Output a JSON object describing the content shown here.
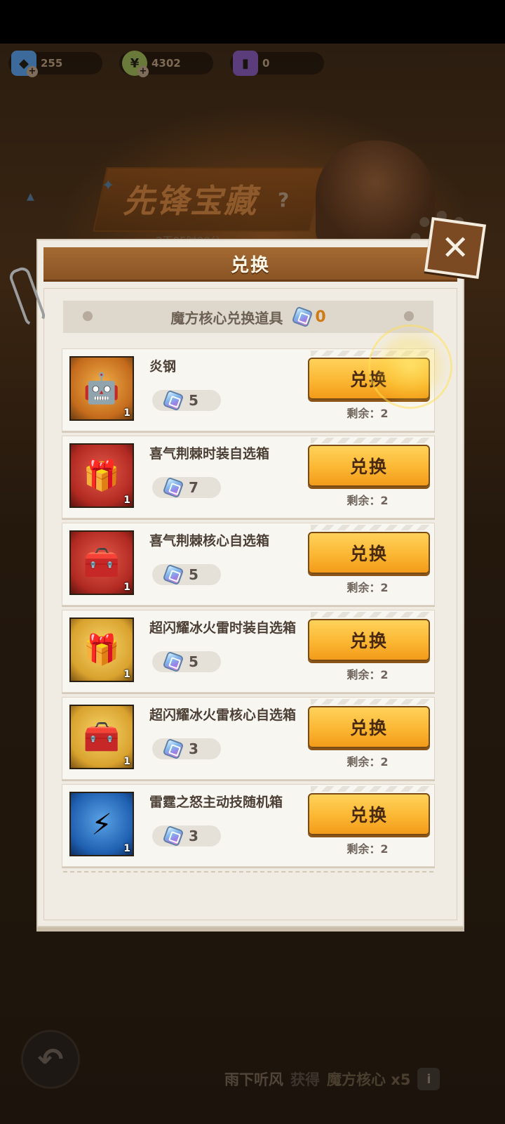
{
  "currencies": [
    {
      "icon": "blue-helmet-icon",
      "value": "255"
    },
    {
      "icon": "green-coin-icon",
      "value": "4302"
    },
    {
      "icon": "purple-card-icon",
      "value": "0"
    }
  ],
  "background": {
    "event_title": "先锋宝藏",
    "event_sub": "2天05时00分"
  },
  "modal": {
    "title": "兑换",
    "subtitle": "魔方核心兑换道具",
    "balance": "0",
    "items": [
      {
        "name": "炎钢",
        "qty": "1",
        "cost": "5",
        "button": "兑换",
        "remaining": "剩余：2",
        "icon": "mech-robot-icon",
        "bg": "orange"
      },
      {
        "name": "喜气荆棘时装自选箱",
        "qty": "1",
        "cost": "7",
        "button": "兑换",
        "remaining": "剩余：2",
        "icon": "gift-box-icon",
        "bg": "red"
      },
      {
        "name": "喜气荆棘核心自选箱",
        "qty": "1",
        "cost": "5",
        "button": "兑换",
        "remaining": "剩余：2",
        "icon": "chest-icon",
        "bg": "red"
      },
      {
        "name": "超闪耀冰火雷时装自选箱",
        "qty": "1",
        "cost": "5",
        "button": "兑换",
        "remaining": "剩余：2",
        "icon": "gift-box-icon",
        "bg": "gold"
      },
      {
        "name": "超闪耀冰火雷核心自选箱",
        "qty": "1",
        "cost": "3",
        "button": "兑换",
        "remaining": "剩余：2",
        "icon": "chest-icon",
        "bg": "gold"
      },
      {
        "name": "雷霆之怒主动技随机箱",
        "qty": "1",
        "cost": "3",
        "button": "兑换",
        "remaining": "剩余：2",
        "icon": "lightning-chest-icon",
        "bg": "blue"
      }
    ]
  },
  "ticker": {
    "player": "雨下听风",
    "verb": "获得",
    "item": "魔方核心 x5"
  }
}
